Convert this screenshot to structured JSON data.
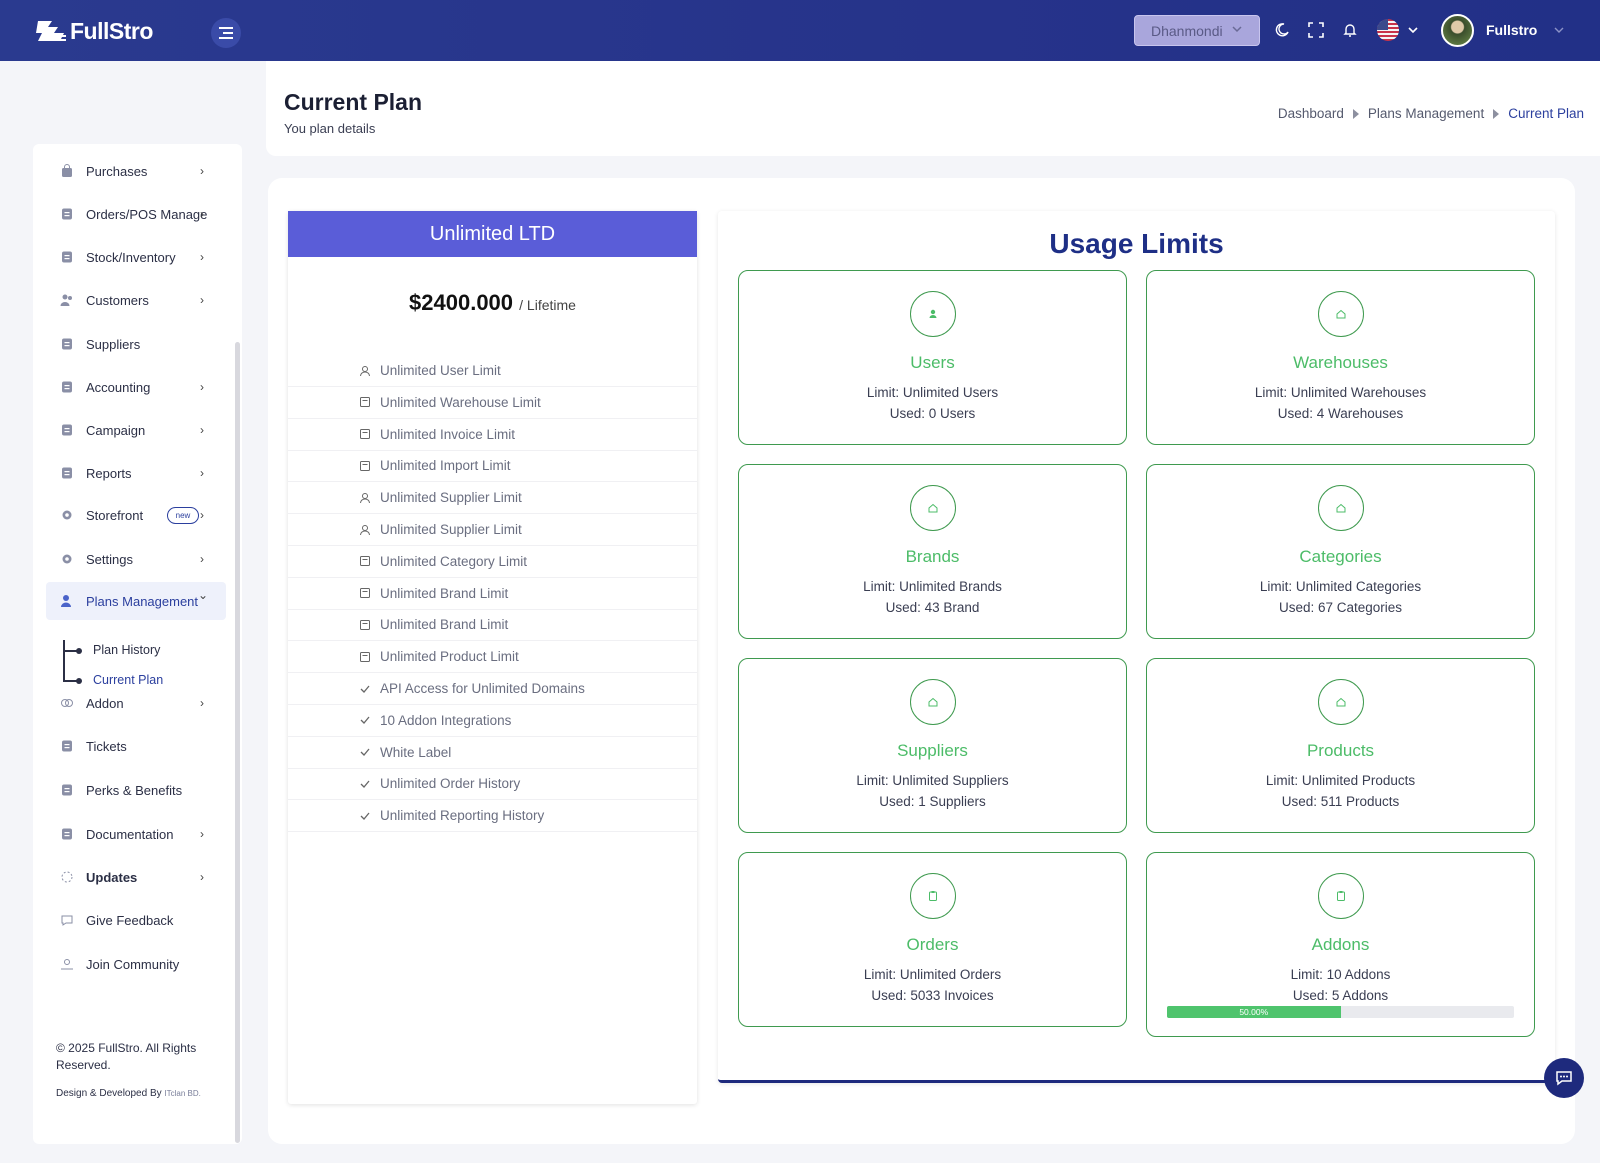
{
  "header": {
    "logo_text": "FullStro",
    "branch": "Dhanmondi",
    "username": "Fullstro"
  },
  "sidebar": {
    "items": [
      {
        "label": "Purchases",
        "icon": "bag-icon",
        "arrow": true
      },
      {
        "label": "Orders/POS Manage",
        "icon": "clipboard-icon",
        "arrow": true
      },
      {
        "label": "Stock/Inventory",
        "icon": "box-icon",
        "arrow": true
      },
      {
        "label": "Customers",
        "icon": "users-icon",
        "arrow": true
      },
      {
        "label": "Suppliers",
        "icon": "supplier-icon",
        "arrow": false
      },
      {
        "label": "Accounting",
        "icon": "ledger-icon",
        "arrow": true
      },
      {
        "label": "Campaign",
        "icon": "megaphone-icon",
        "arrow": true
      },
      {
        "label": "Reports",
        "icon": "report-icon",
        "arrow": true
      },
      {
        "label": "Storefront",
        "icon": "store-icon",
        "arrow": true,
        "badge": "new"
      },
      {
        "label": "Settings",
        "icon": "gear-icon",
        "arrow": true
      },
      {
        "label": "Plans Management",
        "icon": "user-plan-icon",
        "arrow": true,
        "active": true
      },
      {
        "label": "Addon",
        "icon": "addon-icon",
        "arrow": true
      },
      {
        "label": "Tickets",
        "icon": "ticket-icon",
        "arrow": false
      },
      {
        "label": "Perks & Benefits",
        "icon": "gift-icon",
        "arrow": false
      },
      {
        "label": "Documentation",
        "icon": "document-icon",
        "arrow": true
      },
      {
        "label": "Updates",
        "icon": "updates-icon",
        "arrow": true
      },
      {
        "label": "Give Feedback",
        "icon": "feedback-icon",
        "arrow": false
      },
      {
        "label": "Join Community",
        "icon": "community-icon",
        "arrow": false
      }
    ],
    "subitems": [
      "Plan History",
      "Current Plan"
    ],
    "copyright": "© 2025 FullStro. All Rights Reserved.",
    "dev_label": "Design & Developed By",
    "dev_company": "ITclan BD."
  },
  "page": {
    "title": "Current Plan",
    "subtitle": "You plan details",
    "breadcrumb": [
      "Dashboard",
      "Plans Management",
      "Current Plan"
    ]
  },
  "plan": {
    "name": "Unlimited LTD",
    "price": "$2400.000",
    "period": "/ Lifetime",
    "features": [
      {
        "label": "Unlimited User Limit",
        "icon": "user-outline-icon"
      },
      {
        "label": "Unlimited Warehouse Limit",
        "icon": "warehouse-outline-icon"
      },
      {
        "label": "Unlimited Invoice Limit",
        "icon": "invoice-outline-icon"
      },
      {
        "label": "Unlimited Import Limit",
        "icon": "import-outline-icon"
      },
      {
        "label": "Unlimited Supplier Limit",
        "icon": "supplier-outline-icon"
      },
      {
        "label": "Unlimited Supplier Limit",
        "icon": "supplier-outline-icon"
      },
      {
        "label": "Unlimited Category Limit",
        "icon": "folder-outline-icon"
      },
      {
        "label": "Unlimited Brand Limit",
        "icon": "brand-outline-icon"
      },
      {
        "label": "Unlimited Brand Limit",
        "icon": "brand-outline-icon"
      },
      {
        "label": "Unlimited Product Limit",
        "icon": "product-outline-icon"
      },
      {
        "label": "API Access for Unlimited Domains",
        "icon": "check-icon"
      },
      {
        "label": "10 Addon Integrations",
        "icon": "check-icon"
      },
      {
        "label": "White Label",
        "icon": "check-icon"
      },
      {
        "label": "Unlimited Order History",
        "icon": "check-icon"
      },
      {
        "label": "Unlimited Reporting History",
        "icon": "check-icon"
      }
    ]
  },
  "usage": {
    "title": "Usage Limits",
    "cards": [
      {
        "name": "Users",
        "limit": "Limit: Unlimited Users",
        "used": "Used: 0 Users",
        "icon": "user-icon"
      },
      {
        "name": "Warehouses",
        "limit": "Limit: Unlimited Warehouses",
        "used": "Used: 4 Warehouses",
        "icon": "home-icon"
      },
      {
        "name": "Brands",
        "limit": "Limit: Unlimited Brands",
        "used": "Used: 43 Brand",
        "icon": "home-icon"
      },
      {
        "name": "Categories",
        "limit": "Limit: Unlimited Categories",
        "used": "Used: 67 Categories",
        "icon": "home-icon"
      },
      {
        "name": "Suppliers",
        "limit": "Limit: Unlimited Suppliers",
        "used": "Used: 1 Suppliers",
        "icon": "home-icon"
      },
      {
        "name": "Products",
        "limit": "Limit: Unlimited Products",
        "used": "Used: 511 Products",
        "icon": "home-icon"
      },
      {
        "name": "Orders",
        "limit": "Limit: Unlimited Orders",
        "used": "Used: 5033 Invoices",
        "icon": "clipboard-icon"
      },
      {
        "name": "Addons",
        "limit": "Limit: 10 Addons",
        "used": "Used: 5 Addons",
        "icon": "clipboard-icon",
        "progress": 50,
        "progress_label": "50.00%"
      }
    ]
  },
  "colors": {
    "header_bg": "#26338a",
    "accent": "#2b3f9e",
    "plan_header": "#5a5dd8",
    "usage_green": "#4cbc68",
    "card_border": "#3f9a4f"
  }
}
